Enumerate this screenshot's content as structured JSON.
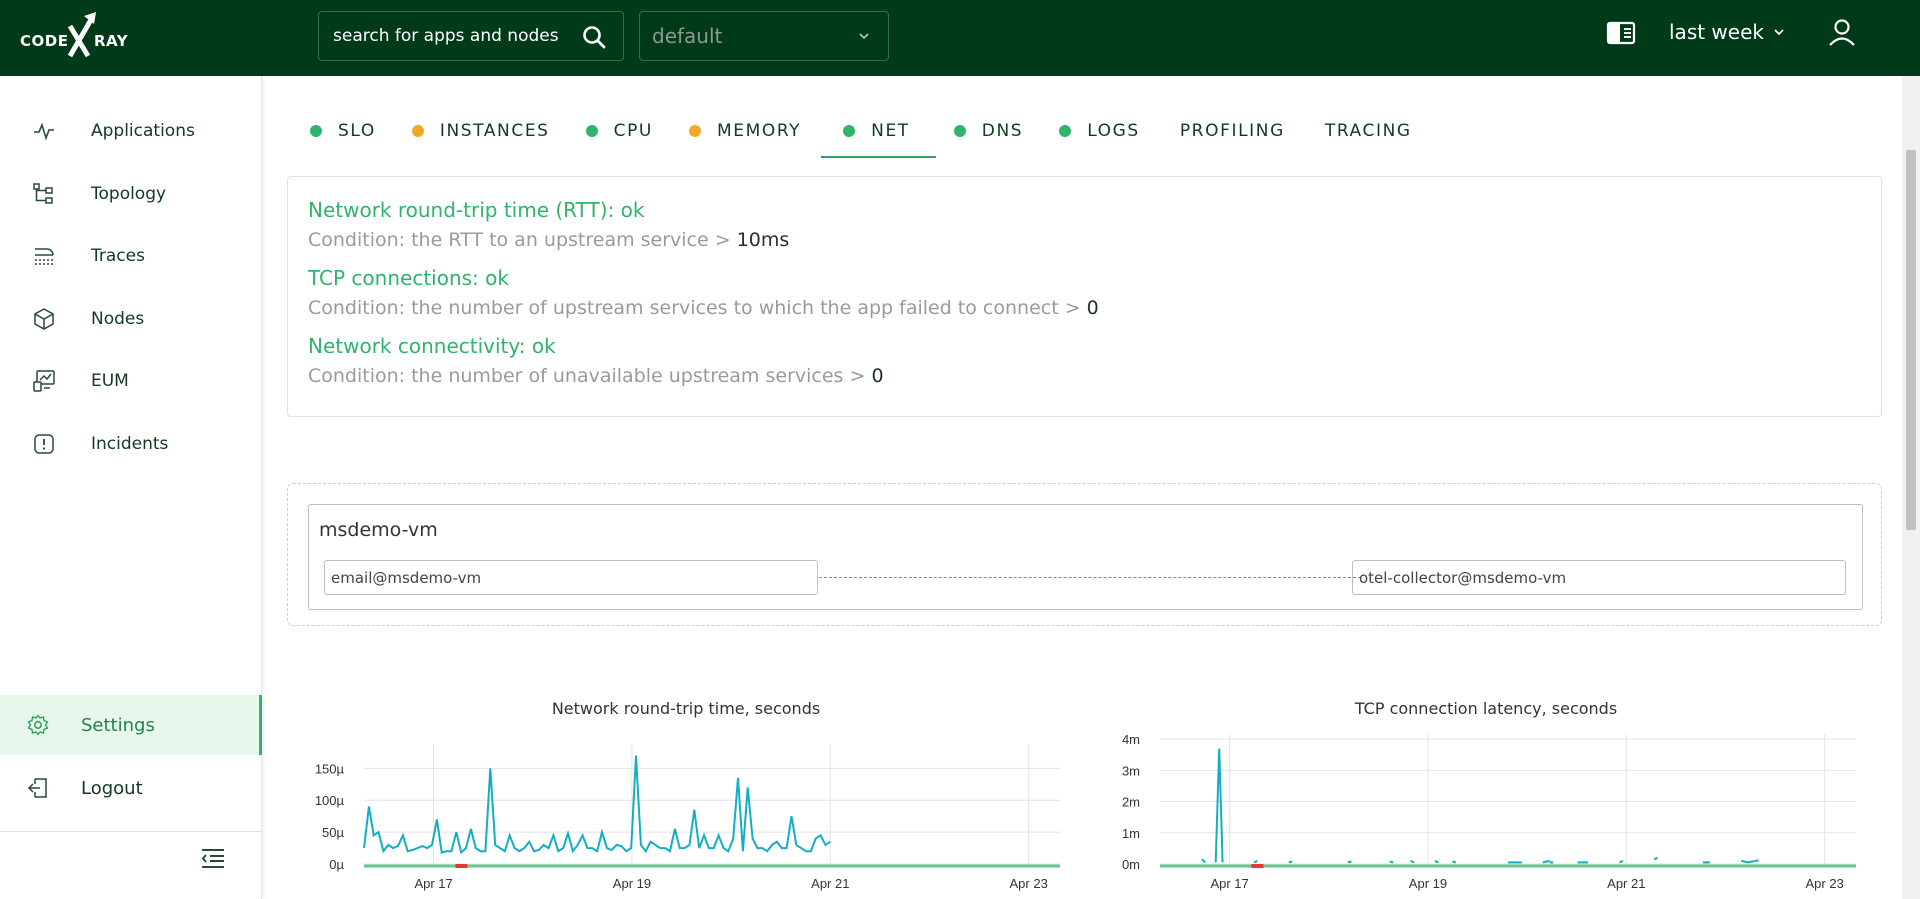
{
  "header": {
    "logo_left": "CODE",
    "logo_right": "RAY",
    "search_placeholder": "search for apps and nodes",
    "project": "default",
    "time_range": "last week"
  },
  "sidebar": {
    "items": [
      {
        "label": "Applications",
        "icon": "pulse-icon"
      },
      {
        "label": "Topology",
        "icon": "topology-icon"
      },
      {
        "label": "Traces",
        "icon": "traces-icon"
      },
      {
        "label": "Nodes",
        "icon": "cube-icon"
      },
      {
        "label": "EUM",
        "icon": "monitor-chart-icon"
      },
      {
        "label": "Incidents",
        "icon": "alert-icon"
      }
    ],
    "settings": "Settings",
    "logout": "Logout"
  },
  "tabs": [
    {
      "label": "SLO",
      "status": "ok"
    },
    {
      "label": "INSTANCES",
      "status": "warning"
    },
    {
      "label": "CPU",
      "status": "ok"
    },
    {
      "label": "MEMORY",
      "status": "warning"
    },
    {
      "label": "NET",
      "status": "ok",
      "active": true
    },
    {
      "label": "DNS",
      "status": "ok"
    },
    {
      "label": "LOGS",
      "status": "ok"
    },
    {
      "label": "PROFILING",
      "status": null
    },
    {
      "label": "TRACING",
      "status": null
    }
  ],
  "colors": {
    "ok": "#2fb56a",
    "warning": "#f4a62a",
    "line": "#14aec4",
    "baseline": "#62c98b",
    "alert": "#e53935"
  },
  "checks": [
    {
      "title": "Network round-trip time (RTT): ok",
      "condition": "Condition: the RTT to an upstream service > ",
      "threshold": "10ms"
    },
    {
      "title": "TCP connections: ok",
      "condition": "Condition: the number of upstream services to which the app failed to connect > ",
      "threshold": "0"
    },
    {
      "title": "Network connectivity: ok",
      "condition": "Condition: the number of unavailable upstream services > ",
      "threshold": "0"
    }
  ],
  "map": {
    "node": "msdemo-vm",
    "source": "email@msdemo-vm",
    "target": "otel-collector@msdemo-vm"
  },
  "chart_data": [
    {
      "type": "line",
      "title": "Network round-trip time, seconds",
      "x_ticks": [
        "Apr 17",
        "Apr 19",
        "Apr 21",
        "Apr 23"
      ],
      "y_ticks": [
        "0µ",
        "50µ",
        "100µ",
        "150µ"
      ],
      "ylim": [
        0,
        185
      ],
      "unit": "µs",
      "series": [
        {
          "values": [
            25,
            90,
            45,
            50,
            20,
            30,
            25,
            28,
            45,
            20,
            22,
            25,
            28,
            25,
            30,
            70,
            18,
            20,
            20,
            50,
            18,
            25,
            55,
            25,
            20,
            20,
            150,
            30,
            25,
            20,
            45,
            25,
            20,
            25,
            35,
            20,
            22,
            30,
            25,
            45,
            20,
            25,
            48,
            20,
            30,
            45,
            25,
            25,
            20,
            50,
            25,
            22,
            30,
            28,
            20,
            25,
            170,
            30,
            20,
            35,
            30,
            25,
            25,
            20,
            55,
            25,
            25,
            30,
            85,
            25,
            45,
            25,
            25,
            45,
            25,
            20,
            40,
            135,
            20,
            120,
            40,
            25,
            25,
            20,
            30,
            35,
            25,
            25,
            75,
            30,
            25,
            20,
            20,
            40,
            45,
            30,
            35
          ]
        }
      ],
      "alert_marker": {
        "x_fraction": 0.14
      }
    },
    {
      "type": "line",
      "title": "TCP connection latency, seconds",
      "x_ticks": [
        "Apr 17",
        "Apr 19",
        "Apr 21",
        "Apr 23"
      ],
      "y_ticks": [
        "0m",
        "1m",
        "2m",
        "3m",
        "4m"
      ],
      "ylim": [
        0,
        4.1
      ],
      "unit": "ms",
      "series": [
        {
          "segments": [
            [
              [
                0.06,
                0.15
              ],
              [
                0.065,
                0.05
              ]
            ],
            [
              [
                0.08,
                0.05
              ],
              [
                0.085,
                3.7
              ],
              [
                0.09,
                0.05
              ]
            ],
            [
              [
                0.135,
                0.05
              ],
              [
                0.14,
                0.1
              ]
            ],
            [
              [
                0.185,
                0.05
              ],
              [
                0.19,
                0.08
              ]
            ],
            [
              [
                0.27,
                0.05
              ],
              [
                0.275,
                0.08
              ]
            ],
            [
              [
                0.33,
                0.08
              ],
              [
                0.335,
                0.05
              ]
            ],
            [
              [
                0.36,
                0.1
              ],
              [
                0.365,
                0.05
              ]
            ],
            [
              [
                0.395,
                0.1
              ],
              [
                0.4,
                0.05
              ]
            ],
            [
              [
                0.42,
                0.08
              ],
              [
                0.425,
                0.05
              ]
            ],
            [
              [
                0.5,
                0.05
              ],
              [
                0.52,
                0.05
              ]
            ],
            [
              [
                0.55,
                0.05
              ],
              [
                0.56,
                0.1
              ]
            ],
            [
              [
                0.56,
                0.05
              ],
              [
                0.565,
                0.05
              ]
            ],
            [
              [
                0.6,
                0.05
              ],
              [
                0.615,
                0.05
              ]
            ],
            [
              [
                0.66,
                0.05
              ],
              [
                0.665,
                0.1
              ]
            ],
            [
              [
                0.71,
                0.15
              ],
              [
                0.715,
                0.2
              ]
            ],
            [
              [
                0.78,
                0.05
              ],
              [
                0.79,
                0.05
              ]
            ],
            [
              [
                0.835,
                0.1
              ],
              [
                0.845,
                0.05
              ],
              [
                0.86,
                0.12
              ]
            ]
          ]
        }
      ],
      "alert_marker": {
        "x_fraction": 0.14
      }
    }
  ]
}
